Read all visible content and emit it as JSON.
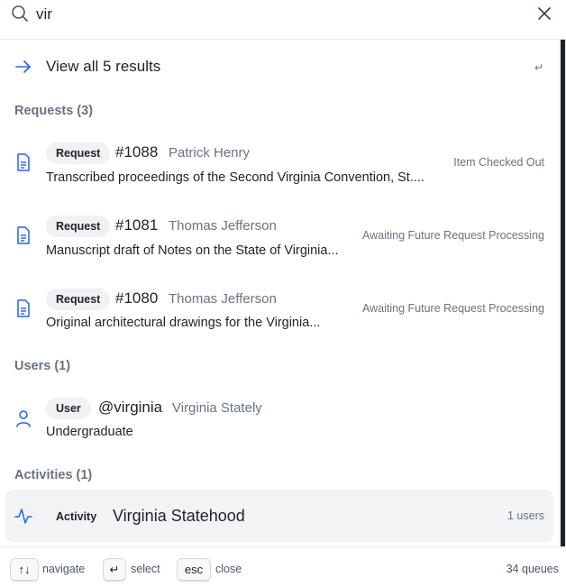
{
  "search": {
    "query": "vir",
    "placeholder": ""
  },
  "view_all": {
    "label": "View all 5 results",
    "shortcut": "↵"
  },
  "sections": {
    "requests": {
      "title": "Requests (3)",
      "items": [
        {
          "badge": "Request",
          "id": "#1088",
          "person": "Patrick Henry",
          "description": "Transcribed proceedings of the Second Virginia Convention, St....",
          "status": "Item Checked Out"
        },
        {
          "badge": "Request",
          "id": "#1081",
          "person": "Thomas Jefferson",
          "description": "Manuscript draft of Notes on the State of Virginia...",
          "status": "Awaiting Future Request Processing"
        },
        {
          "badge": "Request",
          "id": "#1080",
          "person": "Thomas Jefferson",
          "description": "Original architectural drawings for the Virginia...",
          "status": "Awaiting Future Request Processing"
        }
      ]
    },
    "users": {
      "title": "Users (1)",
      "items": [
        {
          "badge": "User",
          "handle": "@virginia",
          "name": "Virginia Stately",
          "description": "Undergraduate"
        }
      ]
    },
    "activities": {
      "title": "Activities (1)",
      "items": [
        {
          "badge": "Activity",
          "name": "Virginia Statehood",
          "count": "1 users"
        }
      ]
    }
  },
  "footer": {
    "navigate_key": "↑↓",
    "navigate_label": "navigate",
    "select_key": "↵",
    "select_label": "select",
    "close_key": "esc",
    "close_label": "close",
    "queue_count": "34 queues"
  },
  "colors": {
    "accent": "#2563eb",
    "muted": "#6b7280",
    "highlight_bg": "#f2f3f5"
  },
  "icons": {
    "search": "search-icon",
    "close": "close-icon",
    "arrow": "arrow-right-icon",
    "document": "document-icon",
    "user": "user-icon",
    "activity": "activity-pulse-icon"
  }
}
